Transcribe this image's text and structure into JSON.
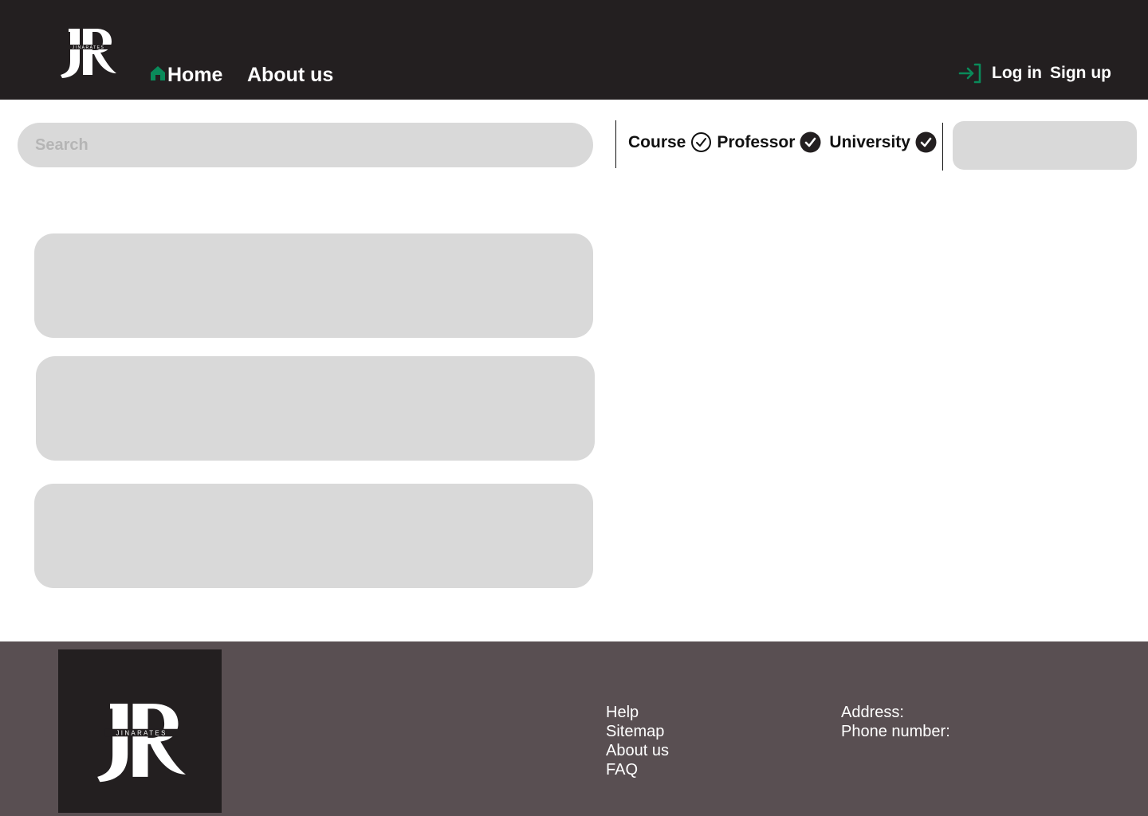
{
  "header": {
    "logo_letters": "JR",
    "logo_wordmark": "JINARATES",
    "nav": {
      "home": "Home",
      "about": "About us"
    },
    "auth": {
      "login": "Log in",
      "signup": "Sign up"
    }
  },
  "search": {
    "placeholder": "Search"
  },
  "filters": [
    {
      "label": "Course",
      "checked": false
    },
    {
      "label": "Professor",
      "checked": true
    },
    {
      "label": "University",
      "checked": true
    }
  ],
  "footer": {
    "links": [
      "Help",
      "Sitemap",
      "About us",
      "FAQ"
    ],
    "contact": {
      "address_label": "Address:",
      "phone_label": "Phone number:"
    }
  },
  "colors": {
    "header_bg": "#231f20",
    "footer_bg": "#594f52",
    "accent_green": "#0a8a5a",
    "placeholder_gray": "#d9d9d9"
  },
  "icons": [
    "home-icon",
    "login-icon",
    "search-icon",
    "check-circle-icon"
  ]
}
